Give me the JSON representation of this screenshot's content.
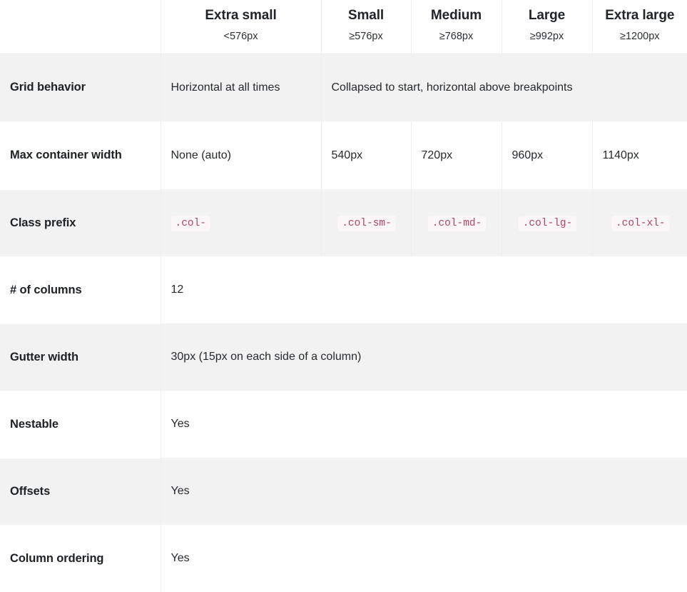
{
  "table": {
    "header": {
      "blank_label": "",
      "breakpoints": [
        {
          "name": "Extra small",
          "size": "<576px"
        },
        {
          "name": "Small",
          "size": "≥576px"
        },
        {
          "name": "Medium",
          "size": "≥768px"
        },
        {
          "name": "Large",
          "size": "≥992px"
        },
        {
          "name": "Extra large",
          "size": "≥1200px"
        }
      ]
    },
    "rows": [
      {
        "label": "Grid behavior",
        "xs": "Horizontal at all times",
        "rest": "Collapsed to start, horizontal above breakpoints"
      },
      {
        "label": "Max container width",
        "xs": "None (auto)",
        "sm": "540px",
        "md": "720px",
        "lg": "960px",
        "xl": "1140px"
      },
      {
        "label": "Class prefix",
        "xs": ".col-",
        "sm": ".col-sm-",
        "md": ".col-md-",
        "lg": ".col-lg-",
        "xl": ".col-xl-"
      },
      {
        "label": "# of columns",
        "value": "12"
      },
      {
        "label": "Gutter width",
        "value": "30px (15px on each side of a column)"
      },
      {
        "label": "Nestable",
        "value": "Yes"
      },
      {
        "label": "Offsets",
        "value": "Yes"
      },
      {
        "label": "Column ordering",
        "value": "Yes"
      }
    ]
  },
  "colors": {
    "stripe": "#f2f2f2",
    "border": "#eceeef",
    "code_text": "#b5416b",
    "code_bg": "#fbf7f8",
    "heading_text": "#212529"
  }
}
